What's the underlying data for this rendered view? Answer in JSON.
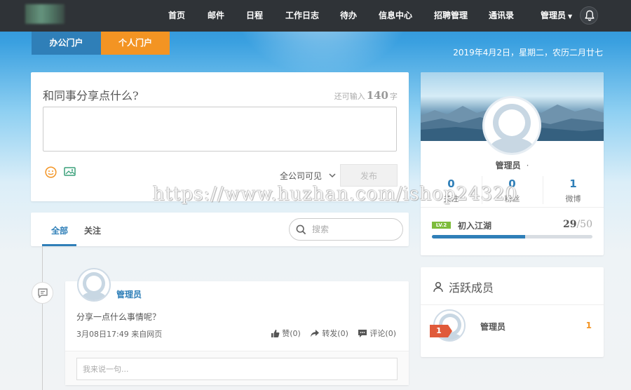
{
  "nav": {
    "items": [
      "首页",
      "邮件",
      "日程",
      "工作日志",
      "待办",
      "信息中心",
      "招聘管理",
      "通讯录"
    ],
    "user": "管理员"
  },
  "portal_tabs": {
    "office": "办公门户",
    "personal": "个人门户"
  },
  "date_text": "2019年4月2日，星期二，农历二月廿七",
  "share": {
    "title": "和同事分享点什么?",
    "remain_prefix": "还可输入",
    "remain_count": "140",
    "remain_suffix": "字",
    "textarea_value": "",
    "visibility": "全公司可见",
    "publish": "发布"
  },
  "feed": {
    "tab_all": "全部",
    "tab_follow": "关注",
    "search_placeholder": "搜索"
  },
  "post": {
    "author": "管理员",
    "text": "分享一点什么事情呢？",
    "meta": "3月08日17:49  来自网页",
    "like": "赞(0)",
    "forward": "转发(0)",
    "comment": "评论(0)",
    "comment_placeholder": "我来说一句..."
  },
  "profile": {
    "name": "管理员",
    "dot": "·",
    "stats": [
      {
        "num": "0",
        "label": "关注"
      },
      {
        "num": "0",
        "label": "粉丝"
      },
      {
        "num": "1",
        "label": "微博"
      }
    ],
    "level_badge": "LV.2",
    "level_name": "初入江湖",
    "score": "29",
    "score_max": "/50",
    "progress": 0.58
  },
  "members": {
    "title": "活跃成员",
    "list": [
      {
        "rank": "1",
        "name": "管理员",
        "count": "1"
      }
    ]
  },
  "watermark": "https://www.huzhan.com/ishop24320",
  "colors": {
    "nav_bg": "#2f3337",
    "accent_blue": "#2f7fb8",
    "accent_orange": "#f39423"
  }
}
